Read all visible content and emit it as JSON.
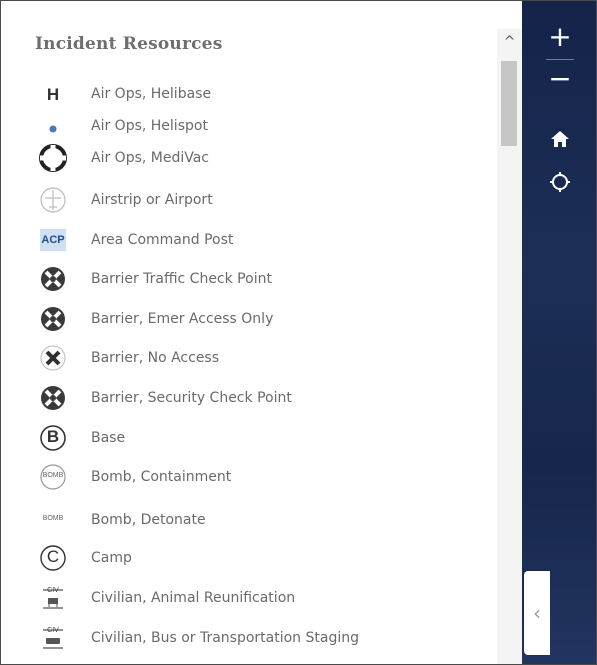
{
  "panel": {
    "title": "Incident Resources",
    "items": [
      {
        "label": "Air Ops, Helibase",
        "icon": "helibase-icon"
      },
      {
        "label": "Air Ops, Helispot",
        "icon": "helispot-icon"
      },
      {
        "label": "Air Ops, MediVac",
        "icon": "medivac-icon"
      },
      {
        "label": "Airstrip or Airport",
        "icon": "airport-icon"
      },
      {
        "label": "Area Command Post",
        "icon": "area-command-post-icon",
        "badge": "ACP"
      },
      {
        "label": "Barrier Traffic Check Point",
        "icon": "barrier-traffic-check-icon"
      },
      {
        "label": "Barrier, Emer Access Only",
        "icon": "barrier-emer-access-icon"
      },
      {
        "label": "Barrier, No Access",
        "icon": "barrier-no-access-icon"
      },
      {
        "label": "Barrier, Security Check Point",
        "icon": "barrier-security-check-icon"
      },
      {
        "label": "Base",
        "icon": "base-icon",
        "badge": "B"
      },
      {
        "label": "Bomb, Containment",
        "icon": "bomb-containment-icon",
        "badge": "BOMB"
      },
      {
        "label": "Bomb, Detonate",
        "icon": "bomb-detonate-icon",
        "badge": "BOMB"
      },
      {
        "label": "Camp",
        "icon": "camp-icon",
        "badge": "C"
      },
      {
        "label": "Civilian, Animal Reunification",
        "icon": "civilian-animal-icon",
        "badge": "CIV"
      },
      {
        "label": "Civilian, Bus or Transportation Staging",
        "icon": "civilian-bus-icon",
        "badge": "CIV"
      }
    ]
  },
  "map_tools": {
    "zoom_in": "+",
    "zoom_out": "−",
    "home": "home-icon",
    "locate": "locate-icon"
  },
  "collapse_tab": {
    "glyph": "‹"
  },
  "scrollbar": {
    "up_glyph": "^"
  }
}
